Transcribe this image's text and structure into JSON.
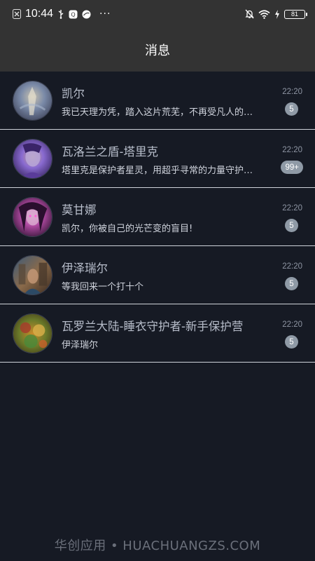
{
  "status_bar": {
    "time": "10:44",
    "more": "···",
    "battery": "81",
    "icons": [
      "x-icon",
      "usb-icon",
      "vpn-icon",
      "app-icon",
      "mute-bell-icon",
      "wifi-icon",
      "charging-icon",
      "battery-icon"
    ]
  },
  "header": {
    "title": "消息"
  },
  "conversations": [
    {
      "name": "凯尔",
      "preview": "我已天理为凭，踏入这片荒芜，不再受凡人的枷锁遏制",
      "time": "22:20",
      "badge": "5",
      "avatar_colors": [
        "#7a8aa8",
        "#3b3f55",
        "#c9c2b0"
      ]
    },
    {
      "name": "瓦洛兰之盾-塔里克",
      "preview": "塔里克是保护者星灵，用超乎寻常的力量守护着符文之地",
      "time": "22:20",
      "badge": "99+",
      "avatar_colors": [
        "#4b2e86",
        "#8a6bd1",
        "#c7a28c"
      ]
    },
    {
      "name": "莫甘娜",
      "preview": "凯尔，你被自己的光芒变的盲目!",
      "time": "22:20",
      "badge": "5",
      "avatar_colors": [
        "#3a1a3c",
        "#b04aa2",
        "#e2b7d6"
      ]
    },
    {
      "name": "伊泽瑞尔",
      "preview": "等我回来一个打十个",
      "time": "22:20",
      "badge": "5",
      "avatar_colors": [
        "#5a4a3a",
        "#8a6a4a",
        "#3c5a78"
      ]
    },
    {
      "name": "瓦罗兰大陆-睡衣守护者-新手保护营",
      "preview": "伊泽瑞尔",
      "time": "22:20",
      "badge": "5",
      "avatar_colors": [
        "#6a7a2a",
        "#c98a2a",
        "#a83a2a"
      ]
    }
  ],
  "watermark": "华创应用 • HUACHUANGZS.COM"
}
